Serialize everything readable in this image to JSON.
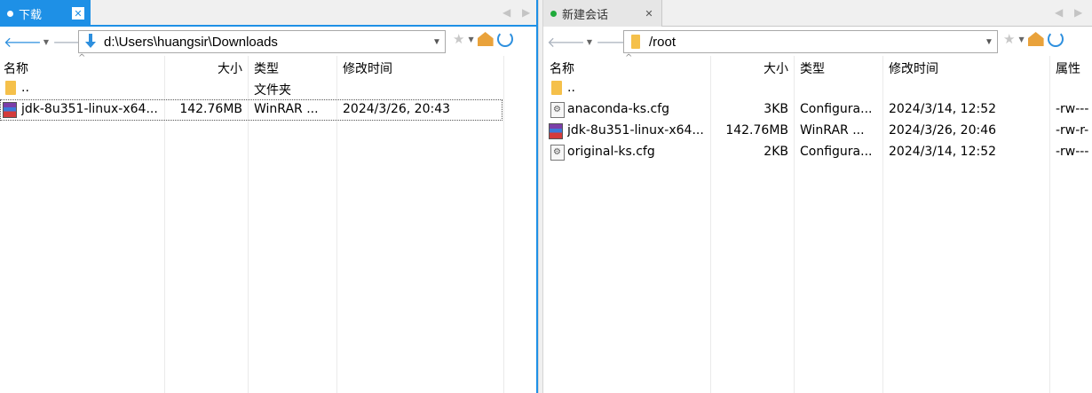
{
  "left": {
    "tab_label": "下载",
    "path": "d:\\Users\\huangsir\\Downloads",
    "columns": [
      "名称",
      "大小",
      "类型",
      "修改时间"
    ],
    "rows": [
      {
        "name": "..",
        "size": "",
        "type": "文件夹",
        "modified": "",
        "icon": "folder-icon"
      },
      {
        "name": "jdk-8u351-linux-x64...",
        "size": "142.76MB",
        "type": "WinRAR ...",
        "modified": "2024/3/26, 20:43",
        "icon": "rar-archive-icon"
      }
    ]
  },
  "right": {
    "tab_label": "新建会话",
    "path": "/root",
    "columns": [
      "名称",
      "大小",
      "类型",
      "修改时间",
      "属性"
    ],
    "rows": [
      {
        "name": "..",
        "size": "",
        "type": "",
        "modified": "",
        "attr": "",
        "icon": "folder-icon"
      },
      {
        "name": "anaconda-ks.cfg",
        "size": "3KB",
        "type": "Configura...",
        "modified": "2024/3/14, 12:52",
        "attr": "-rw---",
        "icon": "config-file-icon"
      },
      {
        "name": "jdk-8u351-linux-x64...",
        "size": "142.76MB",
        "type": "WinRAR ...",
        "modified": "2024/3/26, 20:46",
        "attr": "-rw-r-",
        "icon": "rar-archive-icon"
      },
      {
        "name": "original-ks.cfg",
        "size": "2KB",
        "type": "Configura...",
        "modified": "2024/3/14, 12:52",
        "attr": "-rw---",
        "icon": "config-file-icon"
      }
    ]
  },
  "colors": {
    "accent": "#1e90e6",
    "session_dot": "#1faa3a",
    "folder": "#f5c04a"
  }
}
